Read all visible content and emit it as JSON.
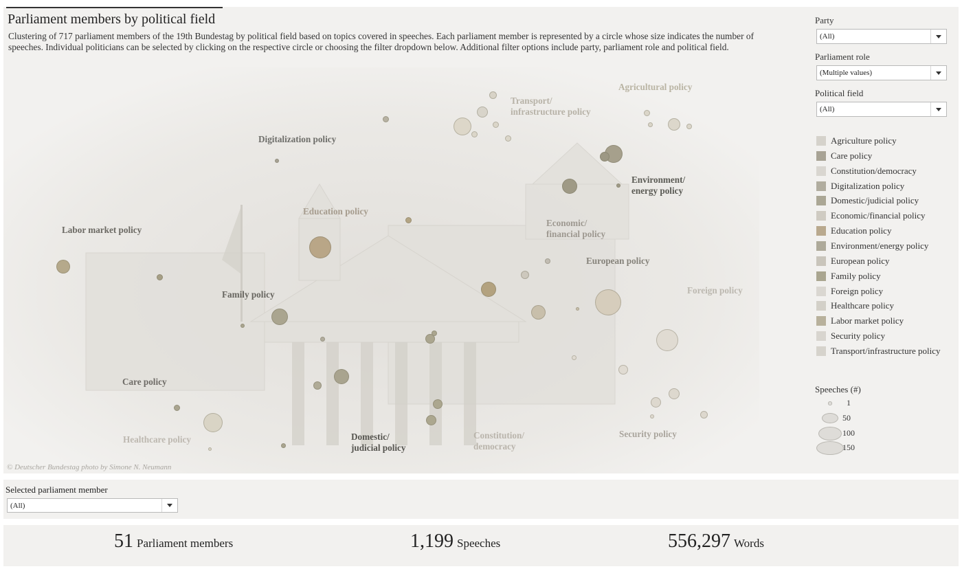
{
  "header": {
    "title": "Parliament members by political field",
    "description": "Clustering of 717 parliament members of the 19th Bundestag by political field based on topics covered in speeches. Each parliament member is represented by a circle whose size indicates the number of speeches. Individual politicians can be selected by clicking on the respective circle or choosing the filter dropdown below. Additional filter options include party, parliament role and political field.",
    "photo_credit": "© Deutscher Bundestag photo by Simone N. Neumann"
  },
  "field_labels": [
    {
      "text": "Transport/\ninfrastructure policy",
      "color": "#b7b2a7"
    },
    {
      "text": "Agricultural policy",
      "color": "#b9b4a3"
    },
    {
      "text": "Digitalization policy",
      "color": "#6e6e6a"
    },
    {
      "text": "Environment/\nenergy policy",
      "color": "#5a5a54"
    },
    {
      "text": "Education policy",
      "color": "#a69c8e"
    },
    {
      "text": "Economic/\nfinancial policy",
      "color": "#9d9890"
    },
    {
      "text": "Labor market policy",
      "color": "#6b6963"
    },
    {
      "text": "European policy",
      "color": "#86837b"
    },
    {
      "text": "Family policy",
      "color": "#67655f"
    },
    {
      "text": "Foreign policy",
      "color": "#bcb8b0"
    },
    {
      "text": "Care policy",
      "color": "#6e6b66"
    },
    {
      "text": "Healthcare policy",
      "color": "#bdb8b0"
    },
    {
      "text": "Domestic/\njudicial policy",
      "color": "#55544f"
    },
    {
      "text": "Constitution/\ndemocracy",
      "color": "#b9b4ab"
    },
    {
      "text": "Security policy",
      "color": "#aaa59d"
    }
  ],
  "filters": {
    "party": {
      "label": "Party",
      "value": "(All)"
    },
    "role": {
      "label": "Parliament role",
      "value": "(Multiple values)"
    },
    "field": {
      "label": "Political field",
      "value": "(All)"
    }
  },
  "legend": [
    {
      "label": "Agriculture policy",
      "color": "#d5d2cb"
    },
    {
      "label": "Care policy",
      "color": "#a8a395"
    },
    {
      "label": "Constitution/democracy",
      "color": "#d9d6d0"
    },
    {
      "label": "Digitalization policy",
      "color": "#b1ad9f"
    },
    {
      "label": "Domestic/judicial policy",
      "color": "#aba795"
    },
    {
      "label": "Economic/financial policy",
      "color": "#cfcbc2"
    },
    {
      "label": "Education policy",
      "color": "#b9a98e"
    },
    {
      "label": "Environment/energy policy",
      "color": "#aeaa9a"
    },
    {
      "label": "European policy",
      "color": "#c9c5bb"
    },
    {
      "label": "Family policy",
      "color": "#aaa690"
    },
    {
      "label": "Foreign policy",
      "color": "#dad7d1"
    },
    {
      "label": "Healthcare policy",
      "color": "#d3d0c8"
    },
    {
      "label": "Labor market policy",
      "color": "#b8b19c"
    },
    {
      "label": "Security policy",
      "color": "#d8d5cf"
    },
    {
      "label": "Transport/infrastructure policy",
      "color": "#d6d3cc"
    }
  ],
  "size_legend": {
    "title": "Speeches (#)",
    "items": [
      {
        "label": "1",
        "speeches": 1
      },
      {
        "label": "50",
        "speeches": 50
      },
      {
        "label": "100",
        "speeches": 100
      },
      {
        "label": "150",
        "speeches": 150
      }
    ]
  },
  "member_filter": {
    "label": "Selected parliament member",
    "value": "(All)"
  },
  "kpis": [
    {
      "value": "51",
      "label": "Parliament members"
    },
    {
      "value": "1,199",
      "label": "Speeches"
    },
    {
      "value": "556,297",
      "label": "Words"
    }
  ]
}
